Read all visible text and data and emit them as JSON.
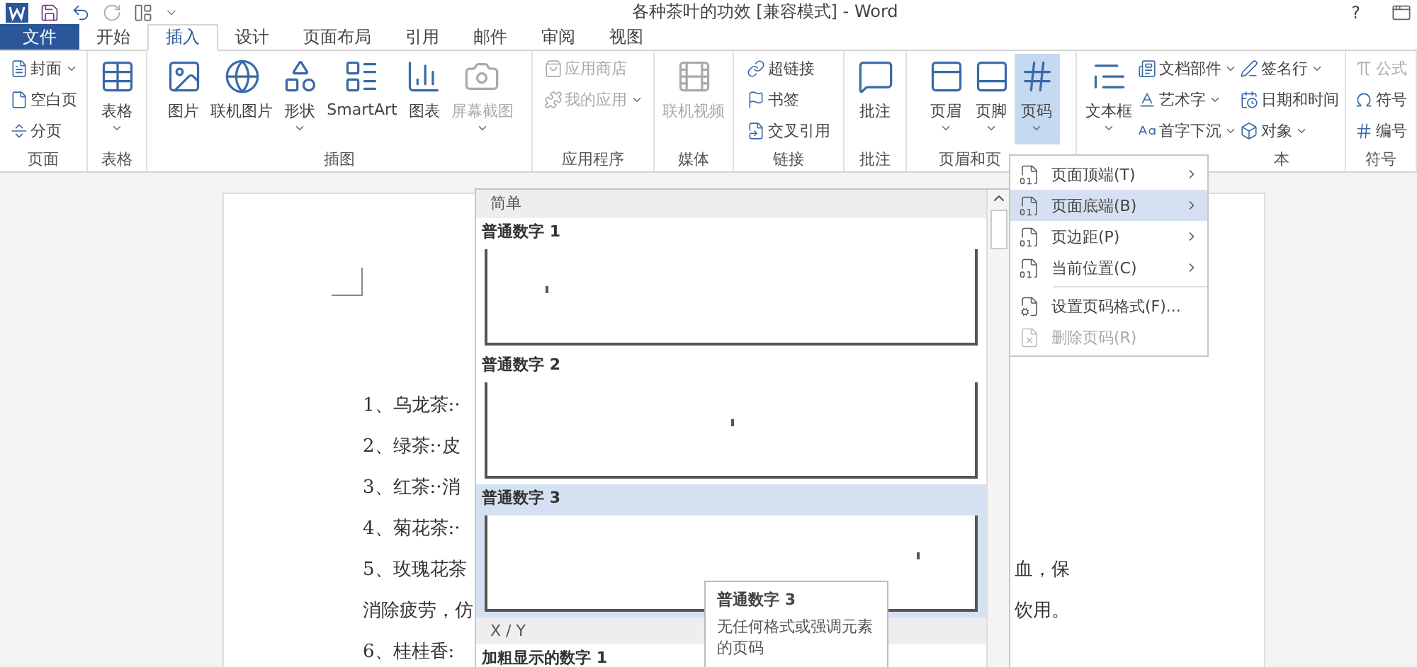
{
  "window": {
    "title": "各种茶叶的功效 [兼容模式] - Word",
    "help": "?"
  },
  "tabs": [
    {
      "label": "文件",
      "kind": "file",
      "selected": false
    },
    {
      "label": "开始",
      "kind": "tab",
      "selected": false
    },
    {
      "label": "插入",
      "kind": "tab",
      "selected": true
    },
    {
      "label": "设计",
      "kind": "tab",
      "selected": false
    },
    {
      "label": "页面布局",
      "kind": "tab",
      "selected": false
    },
    {
      "label": "引用",
      "kind": "tab",
      "selected": false
    },
    {
      "label": "邮件",
      "kind": "tab",
      "selected": false
    },
    {
      "label": "审阅",
      "kind": "tab",
      "selected": false
    },
    {
      "label": "视图",
      "kind": "tab",
      "selected": false
    }
  ],
  "ribbon": {
    "groups": [
      {
        "label": "页面",
        "items": [
          {
            "label": "封面",
            "kind": "small",
            "dropdown": true,
            "disabled": false,
            "selected": false
          },
          {
            "label": "空白页",
            "kind": "small",
            "dropdown": false,
            "disabled": false,
            "selected": false
          },
          {
            "label": "分页",
            "kind": "small",
            "dropdown": false,
            "disabled": false,
            "selected": false
          }
        ]
      },
      {
        "label": "表格",
        "items": [
          {
            "label": "表格",
            "kind": "large",
            "dropdown": true,
            "disabled": false,
            "selected": false
          }
        ]
      },
      {
        "label": "插图",
        "items": [
          {
            "label": "图片",
            "kind": "large",
            "dropdown": false,
            "disabled": false,
            "selected": false
          },
          {
            "label": "联机图片",
            "kind": "large",
            "dropdown": false,
            "disabled": false,
            "selected": false
          },
          {
            "label": "形状",
            "kind": "large",
            "dropdown": true,
            "disabled": false,
            "selected": false
          },
          {
            "label": "SmartArt",
            "kind": "large",
            "dropdown": false,
            "disabled": false,
            "selected": false
          },
          {
            "label": "图表",
            "kind": "large",
            "dropdown": false,
            "disabled": false,
            "selected": false
          },
          {
            "label": "屏幕截图",
            "kind": "large",
            "dropdown": true,
            "disabled": true,
            "selected": false
          }
        ]
      },
      {
        "label": "应用程序",
        "items": [
          {
            "label": "应用商店",
            "kind": "small",
            "dropdown": false,
            "disabled": true,
            "selected": false
          },
          {
            "label": "我的应用",
            "kind": "small",
            "dropdown": true,
            "disabled": true,
            "selected": false
          }
        ]
      },
      {
        "label": "媒体",
        "items": [
          {
            "label": "联机视频",
            "kind": "large",
            "dropdown": false,
            "disabled": true,
            "selected": false
          }
        ]
      },
      {
        "label": "链接",
        "items": [
          {
            "label": "超链接",
            "kind": "small",
            "dropdown": false,
            "disabled": false,
            "selected": false
          },
          {
            "label": "书签",
            "kind": "small",
            "dropdown": false,
            "disabled": false,
            "selected": false
          },
          {
            "label": "交叉引用",
            "kind": "small",
            "dropdown": false,
            "disabled": false,
            "selected": false
          }
        ]
      },
      {
        "label": "批注",
        "items": [
          {
            "label": "批注",
            "kind": "large",
            "dropdown": false,
            "disabled": false,
            "selected": false
          }
        ]
      },
      {
        "label": "页眉和页",
        "items": [
          {
            "label": "页眉",
            "kind": "large",
            "dropdown": true,
            "disabled": false,
            "selected": false
          },
          {
            "label": "页脚",
            "kind": "large",
            "dropdown": true,
            "disabled": false,
            "selected": false
          },
          {
            "label": "页码",
            "kind": "large",
            "dropdown": true,
            "disabled": false,
            "selected": true
          }
        ]
      },
      {
        "label": "本",
        "items": [
          {
            "label": "文本框",
            "kind": "large",
            "dropdown": true,
            "disabled": false,
            "selected": false
          },
          {
            "label": "文档部件",
            "kind": "small",
            "dropdown": true,
            "disabled": false,
            "selected": false
          },
          {
            "label": "艺术字",
            "kind": "small",
            "dropdown": true,
            "disabled": false,
            "selected": false
          },
          {
            "label": "首字下沉",
            "kind": "small",
            "dropdown": true,
            "disabled": false,
            "selected": false
          },
          {
            "label": "签名行",
            "kind": "small",
            "dropdown": true,
            "disabled": false,
            "selected": false
          },
          {
            "label": "日期和时间",
            "kind": "small",
            "dropdown": false,
            "disabled": false,
            "selected": false
          },
          {
            "label": "对象",
            "kind": "small",
            "dropdown": true,
            "disabled": false,
            "selected": false
          }
        ]
      },
      {
        "label": "符号",
        "items": [
          {
            "label": "公式",
            "kind": "small",
            "dropdown": false,
            "disabled": true,
            "selected": false
          },
          {
            "label": "符号",
            "kind": "small",
            "dropdown": false,
            "disabled": false,
            "selected": false
          },
          {
            "label": "编号",
            "kind": "small",
            "dropdown": false,
            "disabled": false,
            "selected": false
          }
        ]
      }
    ]
  },
  "document": {
    "lines": [
      {
        "text": "1、乌龙茶:·"
      },
      {
        "text": "2、绿茶:·皮"
      },
      {
        "text": "3、红茶:·消"
      },
      {
        "text": "4、菊花茶:·"
      },
      {
        "text": "5、玫瑰花茶",
        "right": "血，保"
      },
      {
        "text": "消除疲劳，仿",
        "right": "饮用。"
      },
      {
        "text": "6、桂桂香:"
      }
    ]
  },
  "gallery": {
    "entries": [
      {
        "kind": "section",
        "label": "简单"
      },
      {
        "kind": "left",
        "label": "普通数字 1",
        "selected": false
      },
      {
        "kind": "center",
        "label": "普通数字 2",
        "selected": false
      },
      {
        "kind": "right",
        "label": "普通数字 3",
        "selected": true
      },
      {
        "kind": "section",
        "label": "X / Y"
      },
      {
        "kind": "bold",
        "label": "加粗显示的数字 1",
        "selected": false
      }
    ]
  },
  "tooltip": {
    "title": "普通数字 3",
    "text": "无任何格式或强调元素的页码"
  },
  "menu": {
    "items": [
      {
        "label": "页面顶端(T)",
        "submenu": true,
        "disabled": false,
        "selected": false
      },
      {
        "label": "页面底端(B)",
        "submenu": true,
        "disabled": false,
        "selected": true
      },
      {
        "label": "页边距(P)",
        "submenu": true,
        "disabled": false,
        "selected": false
      },
      {
        "label": "当前位置(C)",
        "submenu": true,
        "disabled": false,
        "selected": false
      },
      {
        "label": "设置页码格式(F)...",
        "submenu": false,
        "disabled": false,
        "selected": false
      },
      {
        "label": "删除页码(R)",
        "submenu": false,
        "disabled": true,
        "selected": false
      }
    ]
  }
}
